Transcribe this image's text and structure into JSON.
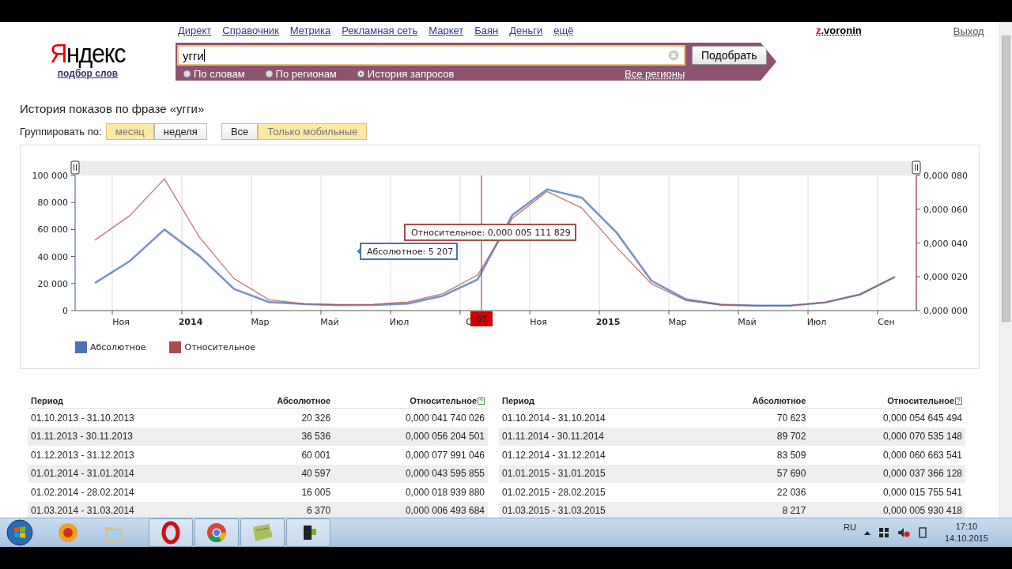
{
  "header": {
    "logo": "Яндекс",
    "logo_sub": "подбор слов",
    "nav": [
      "Директ",
      "Справочник",
      "Метрика",
      "Рекламная сеть",
      "Маркет",
      "Баян",
      "Деньги",
      "ещё"
    ],
    "user": "z.voronin",
    "logout": "Выход"
  },
  "search": {
    "value": "угги",
    "button": "Подобрать",
    "region": "Все регионы",
    "modes": [
      {
        "label": "По словам",
        "selected": false
      },
      {
        "label": "По регионам",
        "selected": false
      },
      {
        "label": "История запросов",
        "selected": true
      }
    ]
  },
  "title": "История показов по фразе «угги»",
  "group_label": "Группировать по:",
  "group": [
    {
      "label": "месяц",
      "selected": true
    },
    {
      "label": "неделя",
      "selected": false
    }
  ],
  "device": [
    {
      "label": "Все",
      "selected": false
    },
    {
      "label": "Только мобильные",
      "selected": true
    }
  ],
  "chart": {
    "chart_data": {
      "type": "line",
      "legend": "bottom",
      "categories": [
        null,
        "Ноя",
        null,
        "2014",
        null,
        "Мар",
        null,
        "Май",
        null,
        "Июл",
        null,
        "С",
        null,
        "Ноя",
        null,
        "2015",
        null,
        "Мар",
        null,
        "Май",
        null,
        "Июл",
        null,
        "Сен"
      ],
      "series": [
        {
          "name": "Абсолютное",
          "color": "#4a72b0",
          "values": [
            20326,
            36536,
            60001,
            40597,
            16005,
            6370,
            4800,
            4000,
            4100,
            5207,
            11000,
            23000,
            70623,
            89702,
            83509,
            57690,
            22036,
            8217,
            4300,
            3700,
            3700,
            6000,
            12000,
            25000
          ]
        },
        {
          "name": "Относительное",
          "color": "#b04a4a",
          "axis": "y2",
          "values": [
            4.17e-05,
            5.62e-05,
            7.8e-05,
            4.36e-05,
            1.89e-05,
            6.5e-06,
            4e-06,
            3.5e-06,
            3.7e-06,
            5.1e-06,
            1e-05,
            2.1e-05,
            5.46e-05,
            7.05e-05,
            6.07e-05,
            3.74e-05,
            1.58e-05,
            5.9e-06,
            3.5e-06,
            3e-06,
            3e-06,
            5e-06,
            9.5e-06,
            2e-05
          ]
        }
      ],
      "ylim": [
        0,
        100000
      ],
      "yticks": [
        {
          "value": 0,
          "label": "0"
        },
        {
          "value": 20000,
          "label": "20 000"
        },
        {
          "value": 40000,
          "label": "40 000"
        },
        {
          "value": 60000,
          "label": "60 000"
        },
        {
          "value": 80000,
          "label": "80 000"
        },
        {
          "value": 100000,
          "label": "100 000"
        }
      ],
      "y2lim": [
        0,
        8e-05
      ],
      "y2ticks": [
        {
          "value": 0,
          "label": "0,000 000"
        },
        {
          "value": 2e-05,
          "label": "0,000 020"
        },
        {
          "value": 4e-05,
          "label": "0,000 040"
        },
        {
          "value": 6e-05,
          "label": "0,000 060"
        },
        {
          "value": 8e-05,
          "label": "0,000 080"
        }
      ],
      "annotations": [
        "07",
        "Относительное: 0,000 005 111 829",
        "Абсолютное: 5 207"
      ]
    }
  },
  "tables": [
    {
      "columns": [
        "Период",
        "Абсолютное",
        "Относительное"
      ],
      "rows": [
        [
          "01.10.2013 - 31.10.2013",
          "20 326",
          "0,000 041 740 026"
        ],
        [
          "01.11.2013 - 30.11.2013",
          "36 536",
          "0,000 056 204 501"
        ],
        [
          "01.12.2013 - 31.12.2013",
          "60 001",
          "0,000 077 991 046"
        ],
        [
          "01.01.2014 - 31.01.2014",
          "40 597",
          "0,000 043 595 855"
        ],
        [
          "01.02.2014 - 28.02.2014",
          "16 005",
          "0,000 018 939 880"
        ],
        [
          "01.03.2014 - 31.03.2014",
          "6 370",
          "0,000 006 493 684"
        ]
      ]
    },
    {
      "columns": [
        "Период",
        "Абсолютное",
        "Относительное"
      ],
      "rows": [
        [
          "01.10.2014 - 31.10.2014",
          "70 623",
          "0,000 054 645 494"
        ],
        [
          "01.11.2014 - 30.11.2014",
          "89 702",
          "0,000 070 535 148"
        ],
        [
          "01.12.2014 - 31.12.2014",
          "83 509",
          "0,000 060 663 541"
        ],
        [
          "01.01.2015 - 31.01.2015",
          "57 690",
          "0,000 037 366 128"
        ],
        [
          "01.02.2015 - 28.02.2015",
          "22 036",
          "0,000 015 755 541"
        ],
        [
          "01.03.2015 - 31.03.2015",
          "8 217",
          "0,000 005 930 418"
        ]
      ]
    }
  ],
  "taskbar": {
    "language": "RU",
    "time": "17:10",
    "date": "14.10.2015"
  }
}
